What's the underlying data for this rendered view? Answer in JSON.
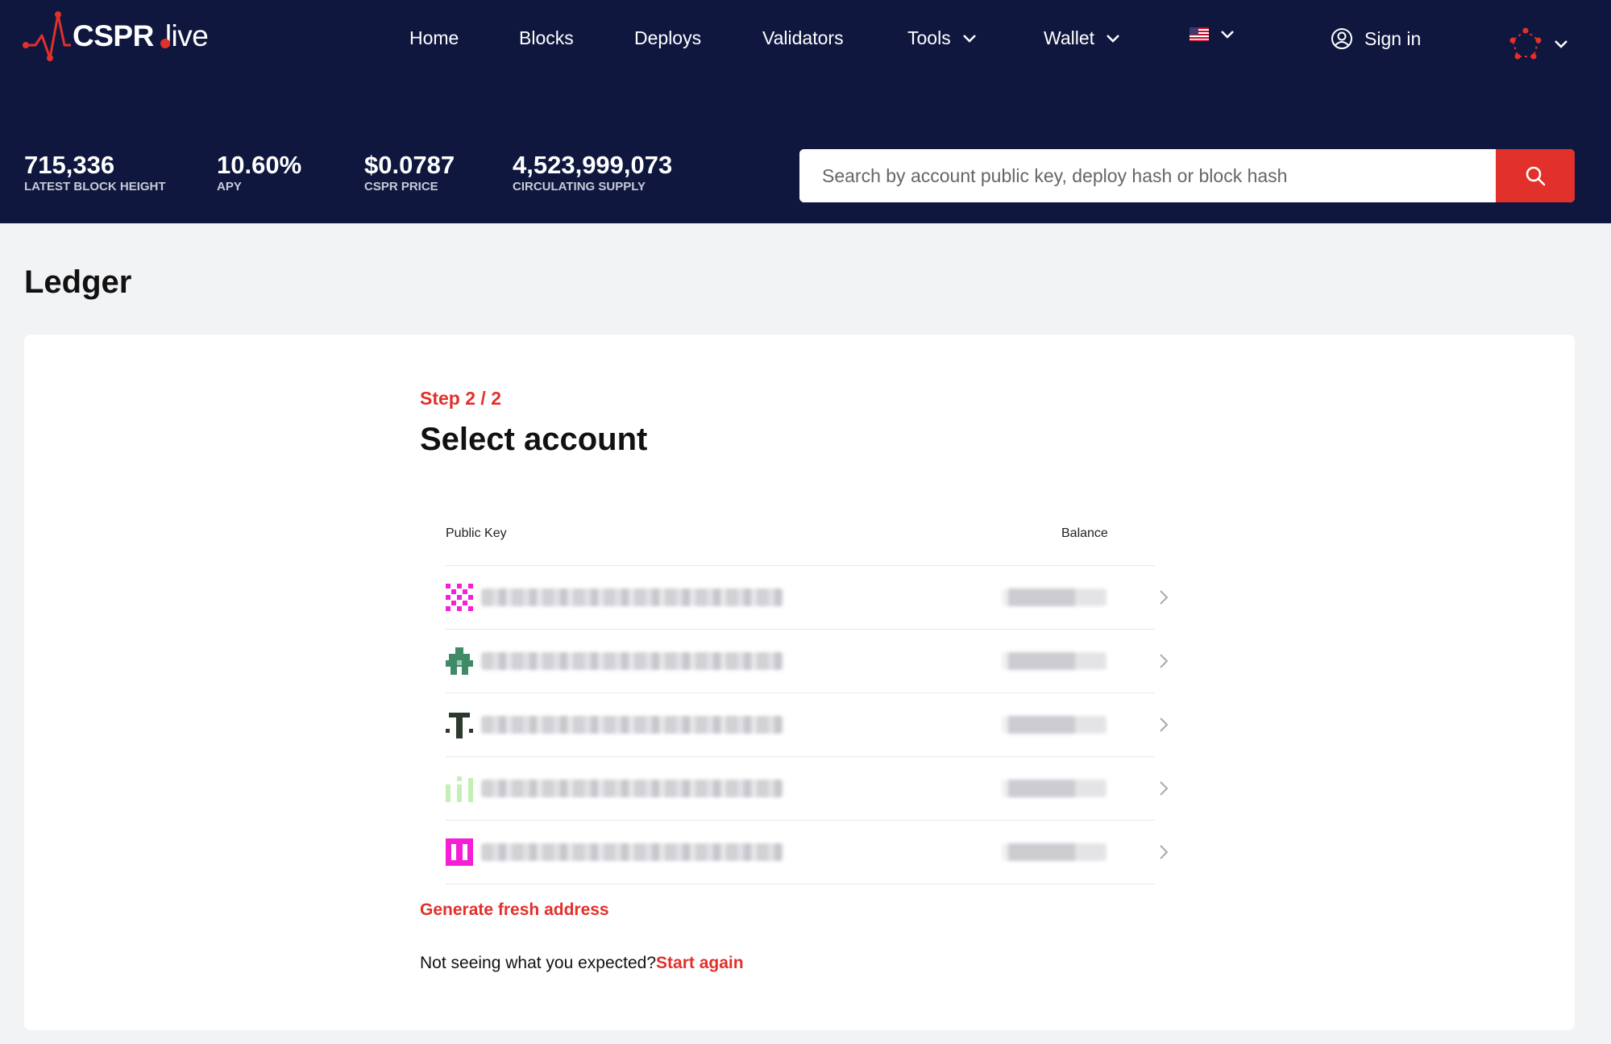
{
  "header": {
    "brand": {
      "name": "CSPR",
      "suffix": "live"
    },
    "nav": [
      {
        "label": "Home",
        "has_dropdown": false
      },
      {
        "label": "Blocks",
        "has_dropdown": false
      },
      {
        "label": "Deploys",
        "has_dropdown": false
      },
      {
        "label": "Validators",
        "has_dropdown": false
      },
      {
        "label": "Tools",
        "has_dropdown": true
      },
      {
        "label": "Wallet",
        "has_dropdown": true
      }
    ],
    "language_icon": "us-flag-icon",
    "sign_in_label": "Sign in",
    "network_icon": "casper-network-icon",
    "stats": [
      {
        "value": "715,336",
        "label": "LATEST BLOCK HEIGHT"
      },
      {
        "value": "10.60%",
        "label": "APY"
      },
      {
        "value": "$0.0787",
        "label": "CSPR PRICE"
      },
      {
        "value": "4,523,999,073",
        "label": "CIRCULATING SUPPLY"
      }
    ],
    "search": {
      "placeholder": "Search by account public key, deploy hash or block hash",
      "value": ""
    }
  },
  "page": {
    "title": "Ledger",
    "step": "Step 2 / 2",
    "heading": "Select account",
    "table": {
      "columns": [
        "Public Key",
        "Balance"
      ],
      "rows": [
        {
          "avatar_color": "#f41fd7",
          "public_key": "blurred",
          "balance": "blurred"
        },
        {
          "avatar_color": "#3f8a67",
          "public_key": "blurred",
          "balance": "blurred"
        },
        {
          "avatar_color": "#2b3a2c",
          "public_key": "blurred",
          "balance": "blurred"
        },
        {
          "avatar_color": "#c5f0b5",
          "public_key": "blurred",
          "balance": "blurred"
        },
        {
          "avatar_color": "#f41fd7",
          "public_key": "blurred",
          "balance": "blurred"
        }
      ]
    },
    "generate_label": "Generate fresh address",
    "restart_prompt": "Not seeing what you expected?",
    "restart_link": "Start again"
  },
  "colors": {
    "header_bg": "#0f173f",
    "accent": "#e2302a",
    "page_bg": "#f2f3f5"
  }
}
